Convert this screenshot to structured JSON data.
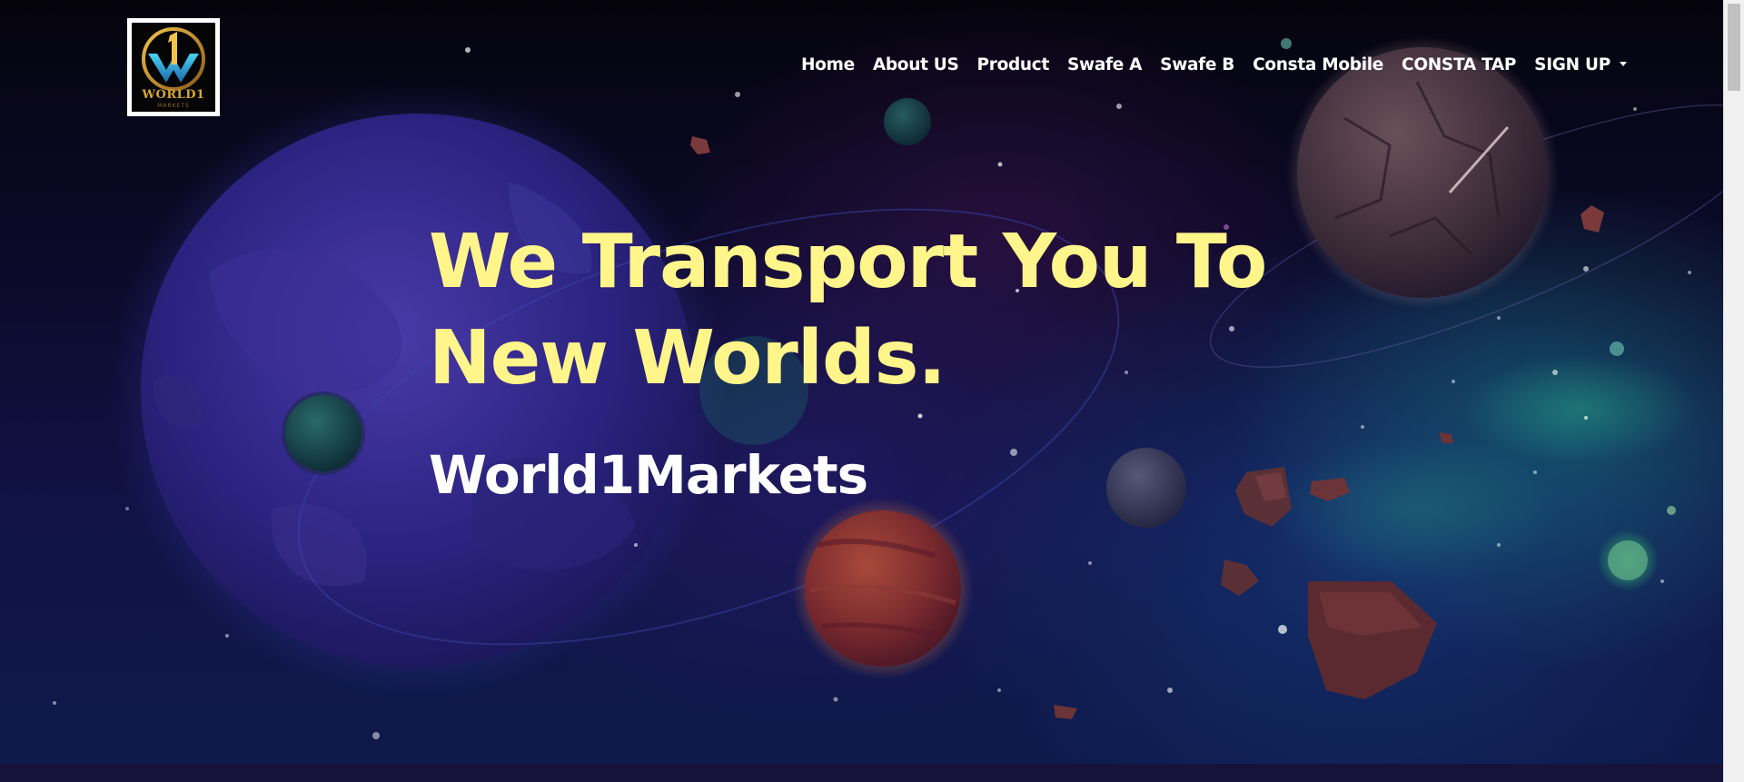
{
  "brand": {
    "logo_text": "WORLD1",
    "logo_subtext": "MARKETS"
  },
  "nav": {
    "items": [
      {
        "label": "Home"
      },
      {
        "label": "About US"
      },
      {
        "label": "Product"
      },
      {
        "label": "Swafe A"
      },
      {
        "label": "Swafe B"
      },
      {
        "label": "Consta Mobile"
      },
      {
        "label": "CONSTA TAP"
      },
      {
        "label": "SIGN UP",
        "has_dropdown": true
      }
    ]
  },
  "hero": {
    "headline_line1": "We Transport You To",
    "headline_line2": "New Worlds.",
    "brand_title": "World1Markets"
  },
  "colors": {
    "headline": "#fff58a",
    "nav_text": "#ffffff",
    "background": "#0c0a2a"
  },
  "icons": {
    "dropdown": "chevron-down-icon",
    "logo": "world1-logo-icon"
  }
}
